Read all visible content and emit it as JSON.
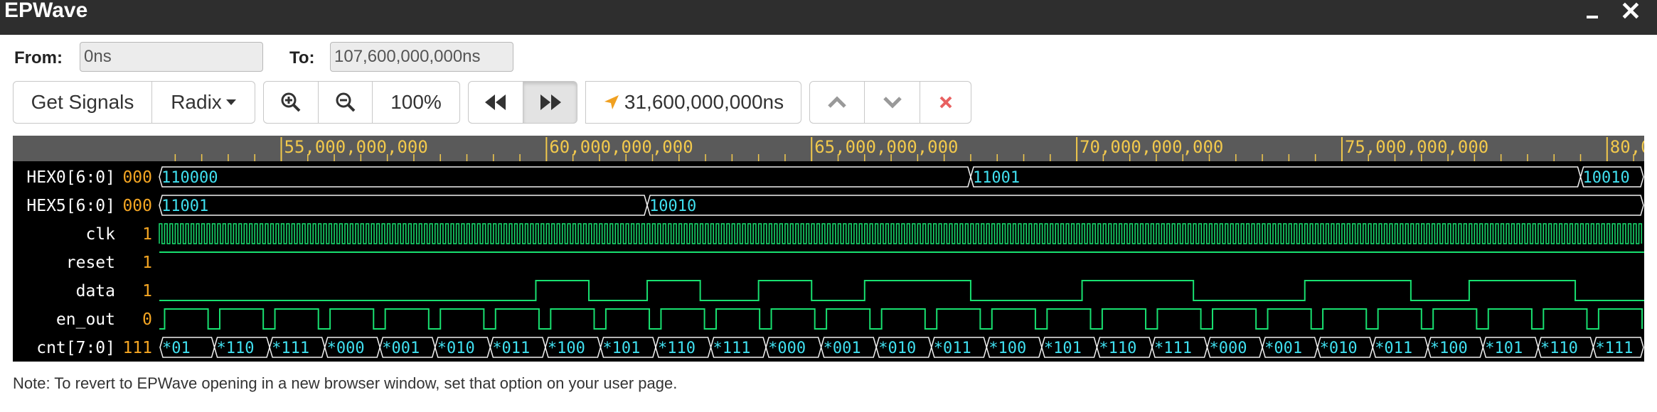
{
  "window": {
    "title": "EPWave",
    "minimize": "minimize",
    "close": "✕"
  },
  "range": {
    "from_label": "From:",
    "from_value": "0ns",
    "to_label": "To:",
    "to_value": "107,600,000,000ns"
  },
  "toolbar": {
    "get_signals": "Get Signals",
    "radix": "Radix",
    "zoom_in": "zoom-in-icon",
    "zoom_out": "zoom-out-icon",
    "zoom_level": "100%",
    "rewind": "rewind-icon",
    "forward": "fast-forward-icon",
    "cursor_time": "31,600,000,000ns",
    "up": "chevron-up-icon",
    "down": "chevron-down-icon",
    "remove": "remove-icon"
  },
  "ruler": {
    "labels": [
      "55,000,000,000",
      "60,000,000,000",
      "65,000,000,000",
      "70,000,000,000",
      "75,000,000,000",
      "80,0"
    ],
    "start": 52700000000,
    "end": 80700000000
  },
  "signals": [
    {
      "name": "HEX0[6:0]",
      "value": "000",
      "type": "bus",
      "segments": [
        {
          "start": 52700000000,
          "end": 68000000000,
          "text": "110000"
        },
        {
          "start": 68000000000,
          "end": 79500000000,
          "text": "11001"
        },
        {
          "start": 79500000000,
          "end": 80700000000,
          "text": "10010"
        }
      ]
    },
    {
      "name": "HEX5[6:0]",
      "value": "000",
      "type": "bus",
      "segments": [
        {
          "start": 52700000000,
          "end": 61900000000,
          "text": "11001"
        },
        {
          "start": 61900000000,
          "end": 80700000000,
          "text": "10010"
        }
      ]
    },
    {
      "name": "clk",
      "value": "1",
      "type": "clock",
      "period": 100000000
    },
    {
      "name": "reset",
      "value": "1",
      "type": "bit",
      "initial": 1,
      "transitions": []
    },
    {
      "name": "data",
      "value": "1",
      "type": "bit",
      "initial": 0,
      "transitions": [
        59800000000,
        60800000000,
        61900000000,
        62900000000,
        64000000000,
        65000000000,
        66000000000,
        68000000000,
        70100000000,
        72200000000,
        74300000000,
        76300000000,
        77400000000,
        79400000000
      ]
    },
    {
      "name": "en_out",
      "value": "0",
      "type": "pulse",
      "first": 52800000000,
      "period": 1040000000,
      "width": 820000000
    },
    {
      "name": "cnt[7:0]",
      "value": "111",
      "type": "bus_step",
      "first": 52700000000,
      "period": 1040000000,
      "labels": [
        "*01",
        "*110",
        "*111",
        "*000",
        "*001",
        "*010",
        "*011",
        "*100",
        "*101",
        "*110",
        "*111",
        "*000",
        "*001",
        "*010",
        "*011",
        "*100",
        "*101",
        "*110",
        "*111",
        "*000",
        "*001",
        "*010",
        "*011",
        "*100",
        "*101",
        "*110",
        "*111"
      ]
    }
  ],
  "note": "Note: To revert to EPWave opening in a new browser window, set that option on your user page."
}
